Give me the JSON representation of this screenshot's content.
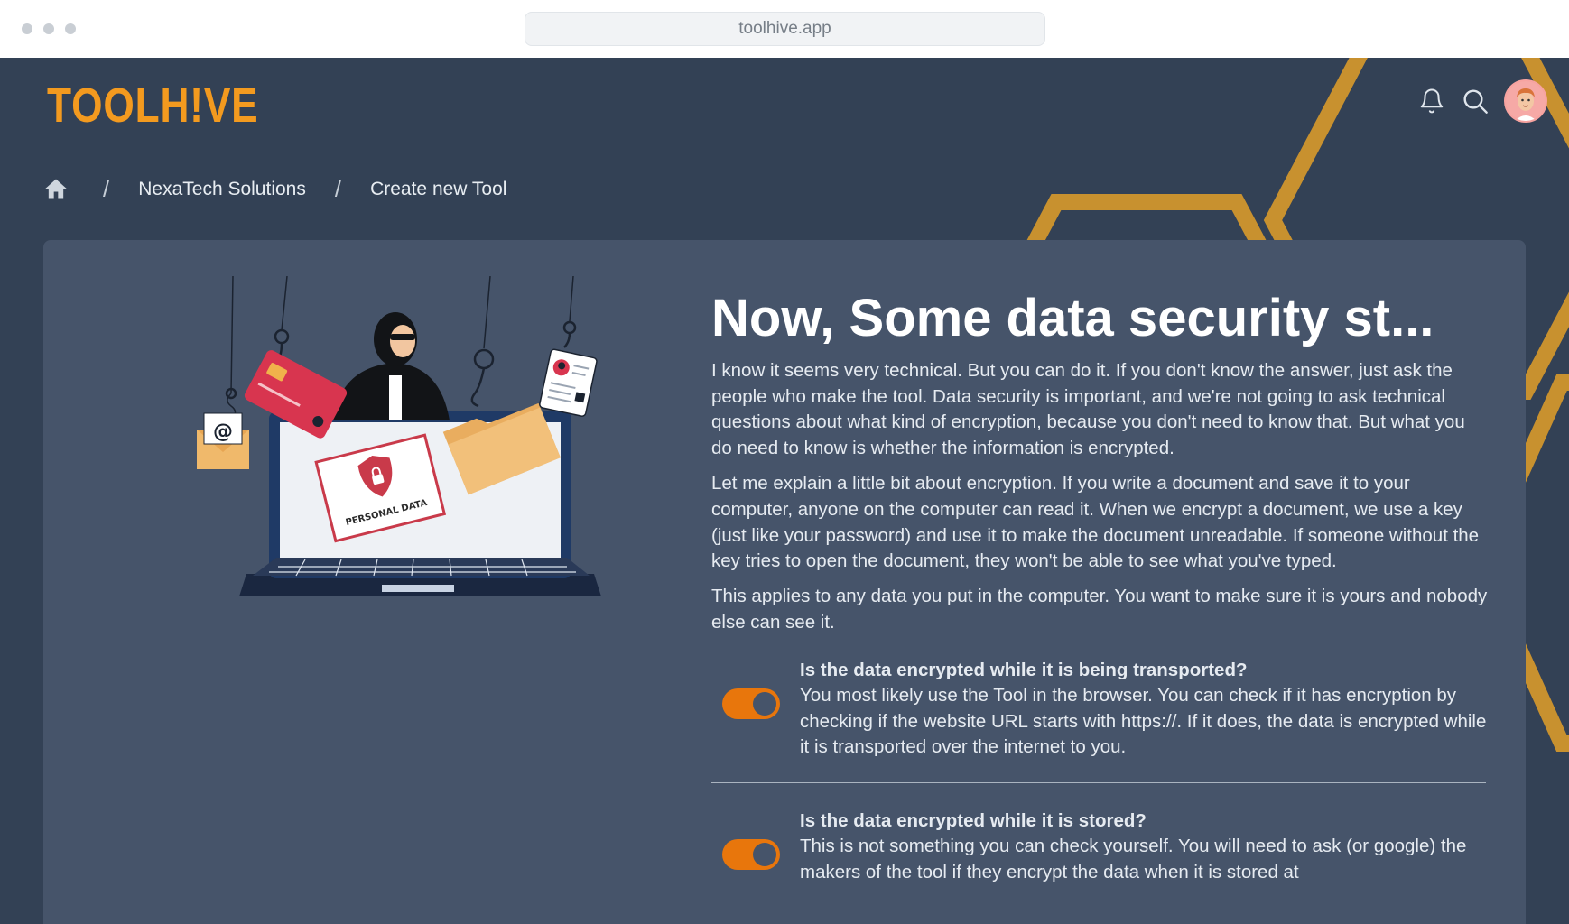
{
  "browser": {
    "url": "toolhive.app"
  },
  "app": {
    "logo_text": "TOOLH!VE",
    "accent_color": "#f39a1f",
    "background_color": "#334155"
  },
  "header": {
    "icons": [
      "bell-icon",
      "search-icon",
      "avatar"
    ]
  },
  "breadcrumb": {
    "home_icon": "home-icon",
    "separator": "/",
    "items": [
      "NexaTech Solutions",
      "Create new Tool"
    ]
  },
  "illustration": {
    "badge_text": "PERSONAL DATA",
    "email_symbol": "@"
  },
  "main": {
    "title": "Now, Some data security st...",
    "paragraphs": [
      "I know it seems very technical. But you can do it. If you don't know the answer, just ask the people who make the tool. Data security is important, and we're not going to ask technical questions about what kind of encryption, because you don't need to know that. But what you do need to know is whether the information is encrypted.",
      "Let me explain a little bit about encryption. If you write a document and save it to your computer, anyone on the computer can read it. When we encrypt a document, we use a key (just like your password) and use it to make the document unreadable. If someone without the key tries to open the document, they won't be able to see what you've typed.",
      "This applies to any data you put in the computer. You want to make sure it is yours and nobody else can see it."
    ],
    "questions": [
      {
        "title": "Is the data encrypted while it is being transported?",
        "body": "You most likely use the Tool in the browser. You can check if it has encryption by checking if the website URL starts with https://. If it does, the data is encrypted while it is transported over the internet to you.",
        "toggle_on": true
      },
      {
        "title": "Is the data encrypted while it is stored?",
        "body": "This is not something you can check yourself. You will need to ask (or google) the makers of the tool if they encrypt the data when it is stored at",
        "toggle_on": true
      }
    ],
    "toggle_color": "#e8760c"
  }
}
